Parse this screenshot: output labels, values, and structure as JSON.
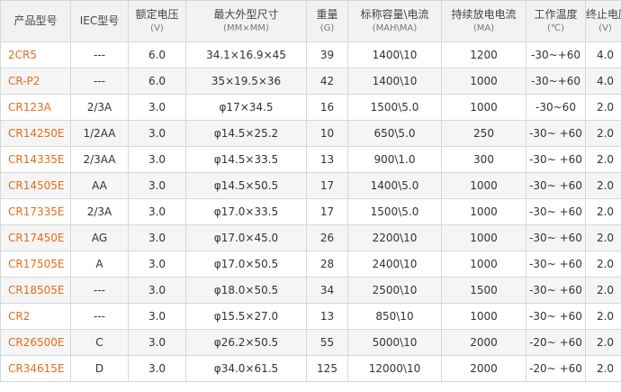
{
  "table": {
    "headers": [
      {
        "label": "产品型号",
        "unit": ""
      },
      {
        "label": "IEC型号",
        "unit": ""
      },
      {
        "label": "额定电压",
        "unit": "(V)"
      },
      {
        "label": "最大外型尺寸",
        "unit": "(MM×MM)"
      },
      {
        "label": "重量",
        "unit": "(G)"
      },
      {
        "label": "标称容量\\电流",
        "unit": "(MAH\\MA)"
      },
      {
        "label": "持续放电电流",
        "unit": "(MA)"
      },
      {
        "label": "工作温度",
        "unit": "(℃)"
      },
      {
        "label": "终止电压",
        "unit": "(V)"
      }
    ],
    "rows": [
      [
        "2CR5",
        "---",
        "6.0",
        "34.1×16.9×45",
        "39",
        "1400\\10",
        "1200",
        "-30~+60",
        "4.0"
      ],
      [
        "CR-P2",
        "---",
        "6.0",
        "35×19.5×36",
        "42",
        "1400\\10",
        "1000",
        "-30~+60",
        "4.0"
      ],
      [
        "CR123A",
        "2/3A",
        "3.0",
        "φ17×34.5",
        "16",
        "1500\\5.0",
        "1000",
        "-30~60",
        "2.0"
      ],
      [
        "CR14250E",
        "1/2AA",
        "3.0",
        "φ14.5×25.2",
        "10",
        "650\\5.0",
        "250",
        "-30~ +60",
        "2.0"
      ],
      [
        "CR14335E",
        "2/3AA",
        "3.0",
        "φ14.5×33.5",
        "13",
        "900\\1.0",
        "300",
        "-30~ +60",
        "2.0"
      ],
      [
        "CR14505E",
        "AA",
        "3.0",
        "φ14.5×50.5",
        "17",
        "1400\\5.0",
        "1000",
        "-30~ +60",
        "2.0"
      ],
      [
        "CR17335E",
        "2/3A",
        "3.0",
        "φ17.0×33.5",
        "17",
        "1500\\5.0",
        "1000",
        "-30~ +60",
        "2.0"
      ],
      [
        "CR17450E",
        "AG",
        "3.0",
        "φ17.0×45.0",
        "26",
        "2200\\10",
        "1000",
        "-30~ +60",
        "2.0"
      ],
      [
        "CR17505E",
        "A",
        "3.0",
        "φ17.0×50.5",
        "28",
        "2400\\10",
        "1000",
        "-30~ +60",
        "2.0"
      ],
      [
        "CR18505E",
        "---",
        "3.0",
        "φ18.0×50.5",
        "34",
        "2500\\10",
        "1500",
        "-30~ +60",
        "2.0"
      ],
      [
        "CR2",
        "---",
        "3.0",
        "φ15.5×27.0",
        "13",
        "850\\10",
        "1000",
        "-30~ +60",
        "2.0"
      ],
      [
        "CR26500E",
        "C",
        "3.0",
        "φ26.2×50.5",
        "55",
        "5000\\10",
        "2000",
        "-20~ +60",
        "2.0"
      ],
      [
        "CR34615E",
        "D",
        "3.0",
        "φ34.0×61.5",
        "125",
        "12000\\10",
        "2000",
        "-20~ +60",
        "2.0"
      ]
    ]
  },
  "colors": {
    "model_link": "#e36d1a",
    "header_bg": "#f2f2f2",
    "stripe_bg": "#f5f5f5",
    "border": "#d7d7d7"
  }
}
